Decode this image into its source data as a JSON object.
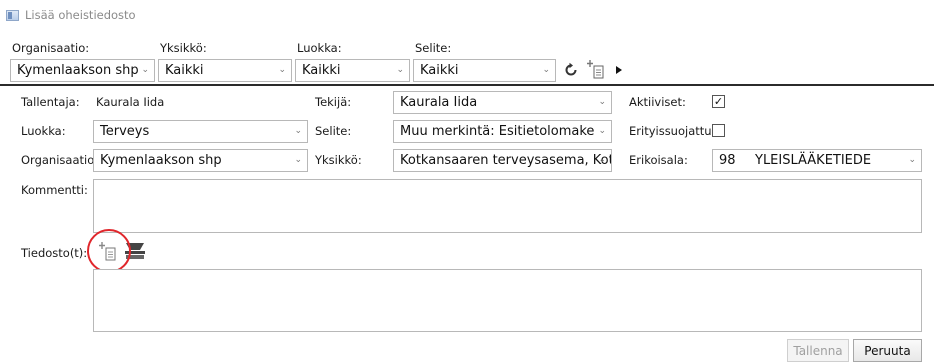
{
  "window": {
    "title": "Lisää oheistiedosto"
  },
  "filters": {
    "organisaatio_label": "Organisaatio:",
    "organisaatio_value": "Kymenlaakson shp",
    "yksikko_label": "Yksikkö:",
    "yksikko_value": "Kaikki",
    "luokka_label": "Luokka:",
    "luokka_value": "Kaikki",
    "selite_label": "Selite:",
    "selite_value": "Kaikki"
  },
  "toolbar_icons": [
    "refresh-icon",
    "attach-file-icon",
    "play-arrow-icon"
  ],
  "form": {
    "tallentaja_label": "Tallentaja:",
    "tallentaja_value": "Kaurala Iida",
    "tekija_label": "Tekijä:",
    "tekija_value": "Kaurala Iida",
    "aktiiviset_label": "Aktiiviset:",
    "aktiiviset_checked": true,
    "luokka_label": "Luokka:",
    "luokka_value": "Terveys",
    "selite_label": "Selite:",
    "selite_value": "Muu merkintä: Esitietolomake",
    "erityissuojattu_label": "Erityissuojattu:",
    "erityissuojattu_checked": false,
    "organisaatio_label": "Organisaatio:",
    "organisaatio_value": "Kymenlaakson shp",
    "yksikko_label": "Yksikkö:",
    "yksikko_value": "Kotkansaaren terveysasema, Kotka",
    "erikoisala_label": "Erikoisala:",
    "erikoisala_code": "98",
    "erikoisala_value": "YLEISLÄÄKETIEDE",
    "kommentti_label": "Kommentti:",
    "kommentti_value": "",
    "tiedostot_label": "Tiedosto(t):"
  },
  "buttons": {
    "tallenna_label": "Tallenna",
    "peruuta_label": "Peruuta"
  },
  "colors": {
    "highlight": "#e0262b",
    "separator": "#2b2b2b"
  }
}
